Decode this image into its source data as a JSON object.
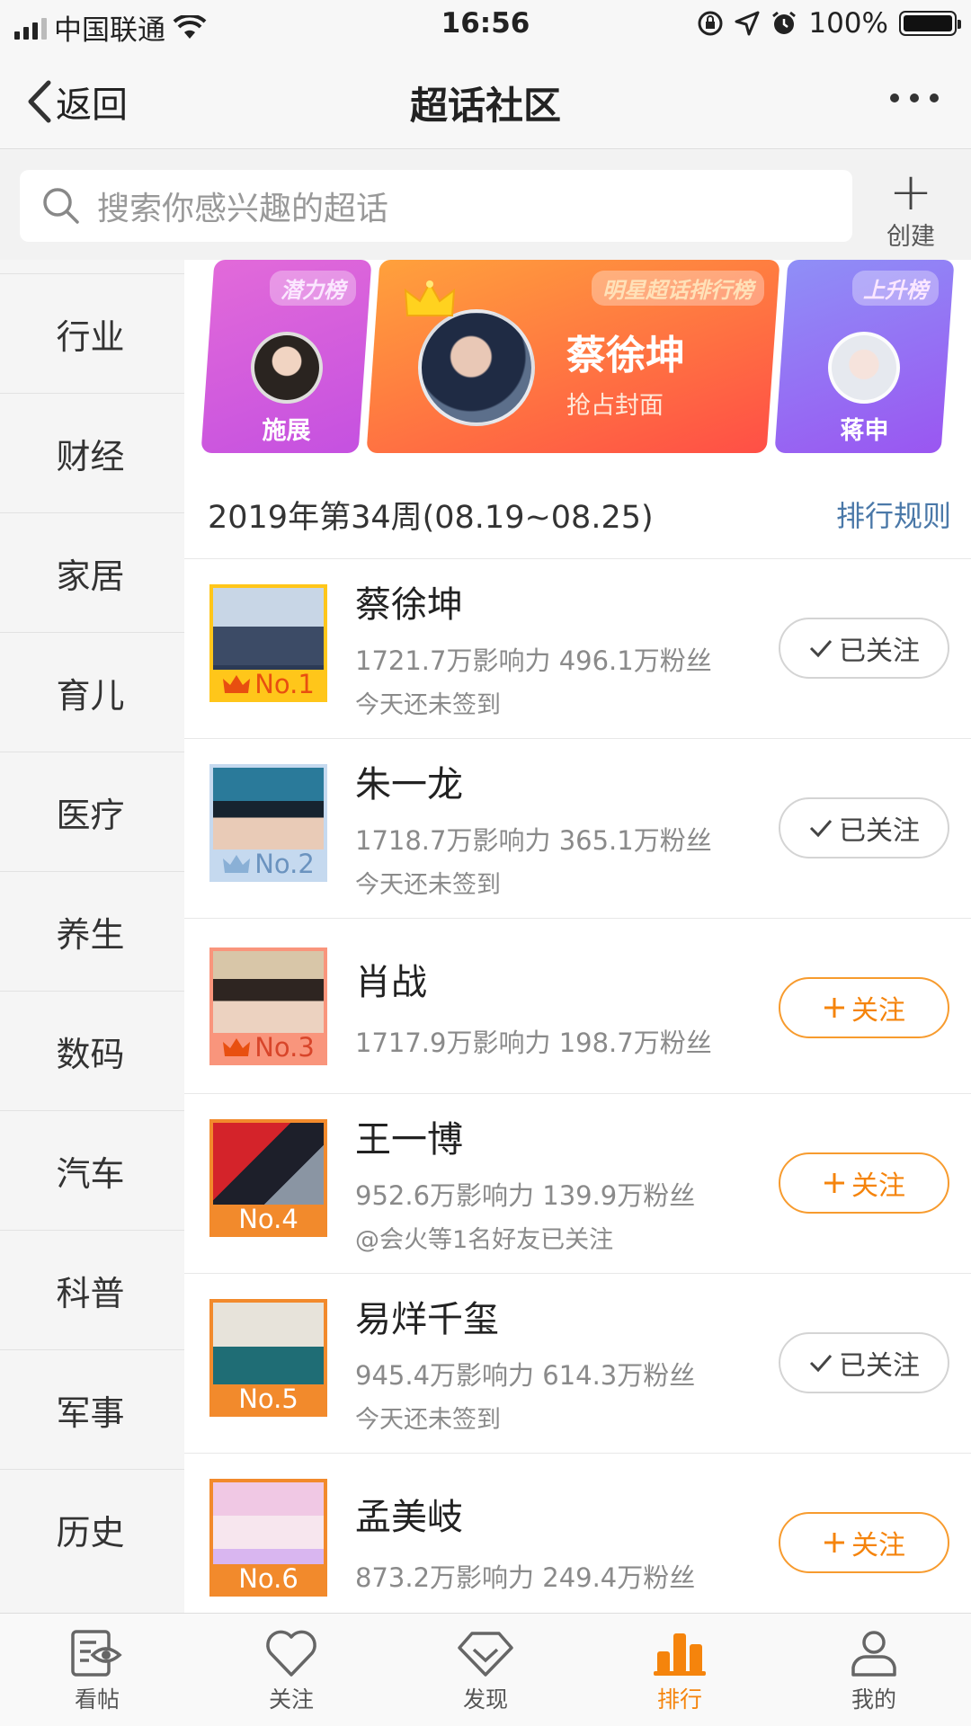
{
  "status_bar": {
    "carrier": "中国联通",
    "time": "16:56",
    "battery": "100%",
    "battery_level": 1.0
  },
  "nav": {
    "back_label": "返回",
    "title": "超话社区"
  },
  "search": {
    "placeholder": "搜索你感兴趣的超话",
    "create_label": "创建"
  },
  "sidebar": {
    "items": [
      "行业",
      "财经",
      "家居",
      "育儿",
      "医疗",
      "养生",
      "数码",
      "汽车",
      "科普",
      "军事",
      "历史"
    ]
  },
  "banner": {
    "left": {
      "tag": "潜力榜",
      "name": "施展"
    },
    "center": {
      "tag": "明星超话排行榜",
      "name": "蔡徐坤",
      "subtitle": "抢占封面"
    },
    "right": {
      "tag": "上升榜",
      "name": "蒋申"
    }
  },
  "week": {
    "label": "2019年第34周(08.19~08.25)",
    "rule_link": "排行规则"
  },
  "ranking": [
    {
      "rank": "No.1",
      "name": "蔡徐坤",
      "stats": "1721.7万影响力 496.1万粉丝",
      "note": "今天还未签到",
      "followed": true,
      "button": "已关注",
      "badge_color": "#ffc61a",
      "text_color": "#e84f10"
    },
    {
      "rank": "No.2",
      "name": "朱一龙",
      "stats": "1718.7万影响力 365.1万粉丝",
      "note": "今天还未签到",
      "followed": true,
      "button": "已关注",
      "badge_color": "#c5d9ef",
      "text_color": "#6b93bf"
    },
    {
      "rank": "No.3",
      "name": "肖战",
      "stats": "1717.9万影响力 198.7万粉丝",
      "note": "",
      "followed": false,
      "button": "关注",
      "badge_color": "#f9957c",
      "text_color": "#d8452a"
    },
    {
      "rank": "No.4",
      "name": "王一博",
      "stats": "952.6万影响力 139.9万粉丝",
      "note": "@会火等1名好友已关注",
      "followed": false,
      "button": "关注",
      "badge_color": "#f28a2c",
      "text_color": "#ffffff"
    },
    {
      "rank": "No.5",
      "name": "易烊千玺",
      "stats": "945.4万影响力 614.3万粉丝",
      "note": "今天还未签到",
      "followed": true,
      "button": "已关注",
      "badge_color": "#f28a2c",
      "text_color": "#ffffff"
    },
    {
      "rank": "No.6",
      "name": "孟美岐",
      "stats": "873.2万影响力 249.4万粉丝",
      "note": "",
      "followed": false,
      "button": "关注",
      "badge_color": "#f28a2c",
      "text_color": "#ffffff"
    }
  ],
  "tabs": [
    {
      "label": "看帖",
      "icon": "eye-doc-icon",
      "active": false
    },
    {
      "label": "关注",
      "icon": "heart-icon",
      "active": false
    },
    {
      "label": "发现",
      "icon": "diamond-icon",
      "active": false
    },
    {
      "label": "排行",
      "icon": "bar-chart-icon",
      "active": true
    },
    {
      "label": "我的",
      "icon": "person-icon",
      "active": false
    }
  ],
  "colors": {
    "accent": "#f5840c",
    "link": "#4a78a8"
  }
}
